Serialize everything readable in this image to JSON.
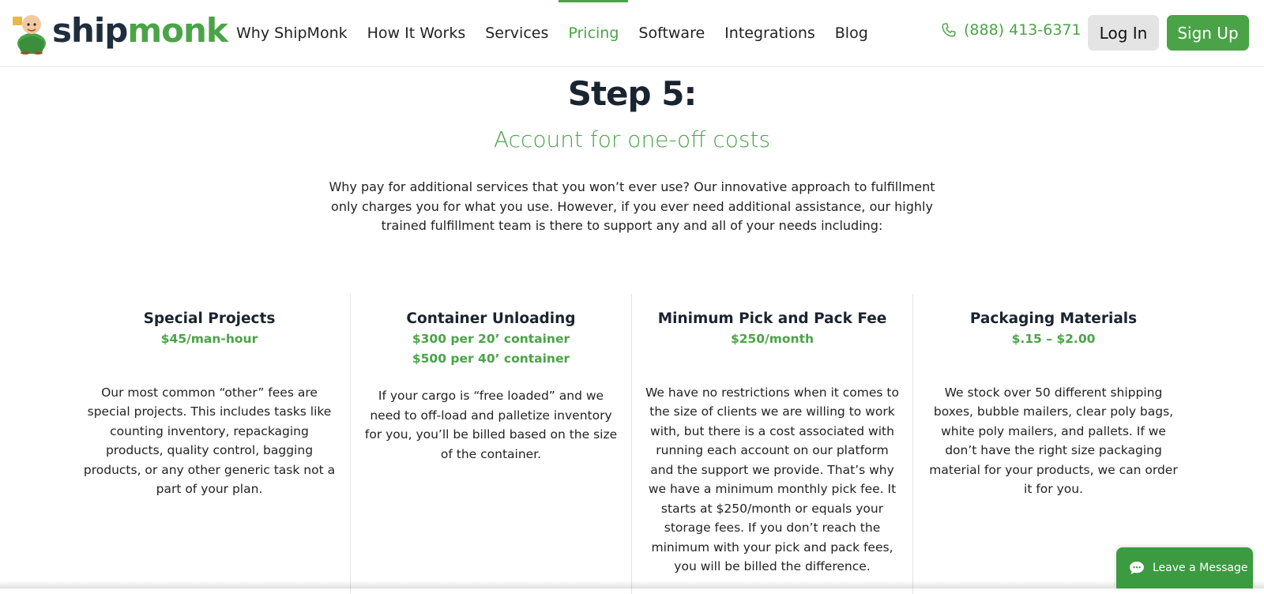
{
  "header": {
    "logo": {
      "part1": "ship",
      "part2": "monk"
    },
    "nav": [
      {
        "label": "Why ShipMonk",
        "active": false
      },
      {
        "label": "How It Works",
        "active": false
      },
      {
        "label": "Services",
        "active": false
      },
      {
        "label": "Pricing",
        "active": true
      },
      {
        "label": "Software",
        "active": false
      },
      {
        "label": "Integrations",
        "active": false
      },
      {
        "label": "Blog",
        "active": false
      }
    ],
    "phone": "(888) 413-6371",
    "login_label": "Log In",
    "signup_label": "Sign Up"
  },
  "main": {
    "title": "Step 5:",
    "subtitle": "Account for one-off costs",
    "intro": "Why pay for additional services that you won’t ever use? Our innovative approach to fulfillment only charges you for what you use. However, if you ever need additional assistance, our highly trained fulfillment team is there to support any and all of your needs including:",
    "columns": [
      {
        "title": "Special Projects",
        "prices": [
          "$45/man-hour"
        ],
        "description": "Our most common “other” fees are special projects. This includes tasks like counting inventory, repackaging products, quality control, bagging products, or any other generic task not a part of your plan."
      },
      {
        "title": "Container Unloading",
        "prices": [
          "$300 per 20’ container",
          "$500 per 40’ container"
        ],
        "description": "If your cargo is “free loaded” and we need to off-load and palletize inventory for you, you’ll be billed based on the size of the container."
      },
      {
        "title": "Minimum Pick and Pack Fee",
        "prices": [
          "$250/month"
        ],
        "description": "We have no restrictions when it comes to the size of clients we are willing to work with, but there is a cost associated with running each account on our platform and the support we provide. That’s why we have a minimum monthly pick fee. It starts at $250/month or equals your storage fees. If you don’t reach the minimum with your pick and pack fees, you will be billed the difference."
      },
      {
        "title": "Packaging Materials",
        "prices": [
          "$.15 – $2.00"
        ],
        "description": "We stock over 50 different shipping boxes, bubble mailers, clear poly bags, white poly mailers, and pallets. If we don’t have the right size packaging material for your products, we can order it for you."
      }
    ]
  },
  "chat": {
    "label": "Leave a Message"
  },
  "colors": {
    "brand_green": "#4aa447",
    "dark_navy": "#1a2430"
  },
  "icons": [
    "monk-mascot-icon",
    "phone-icon",
    "chat-bubble-icon"
  ]
}
